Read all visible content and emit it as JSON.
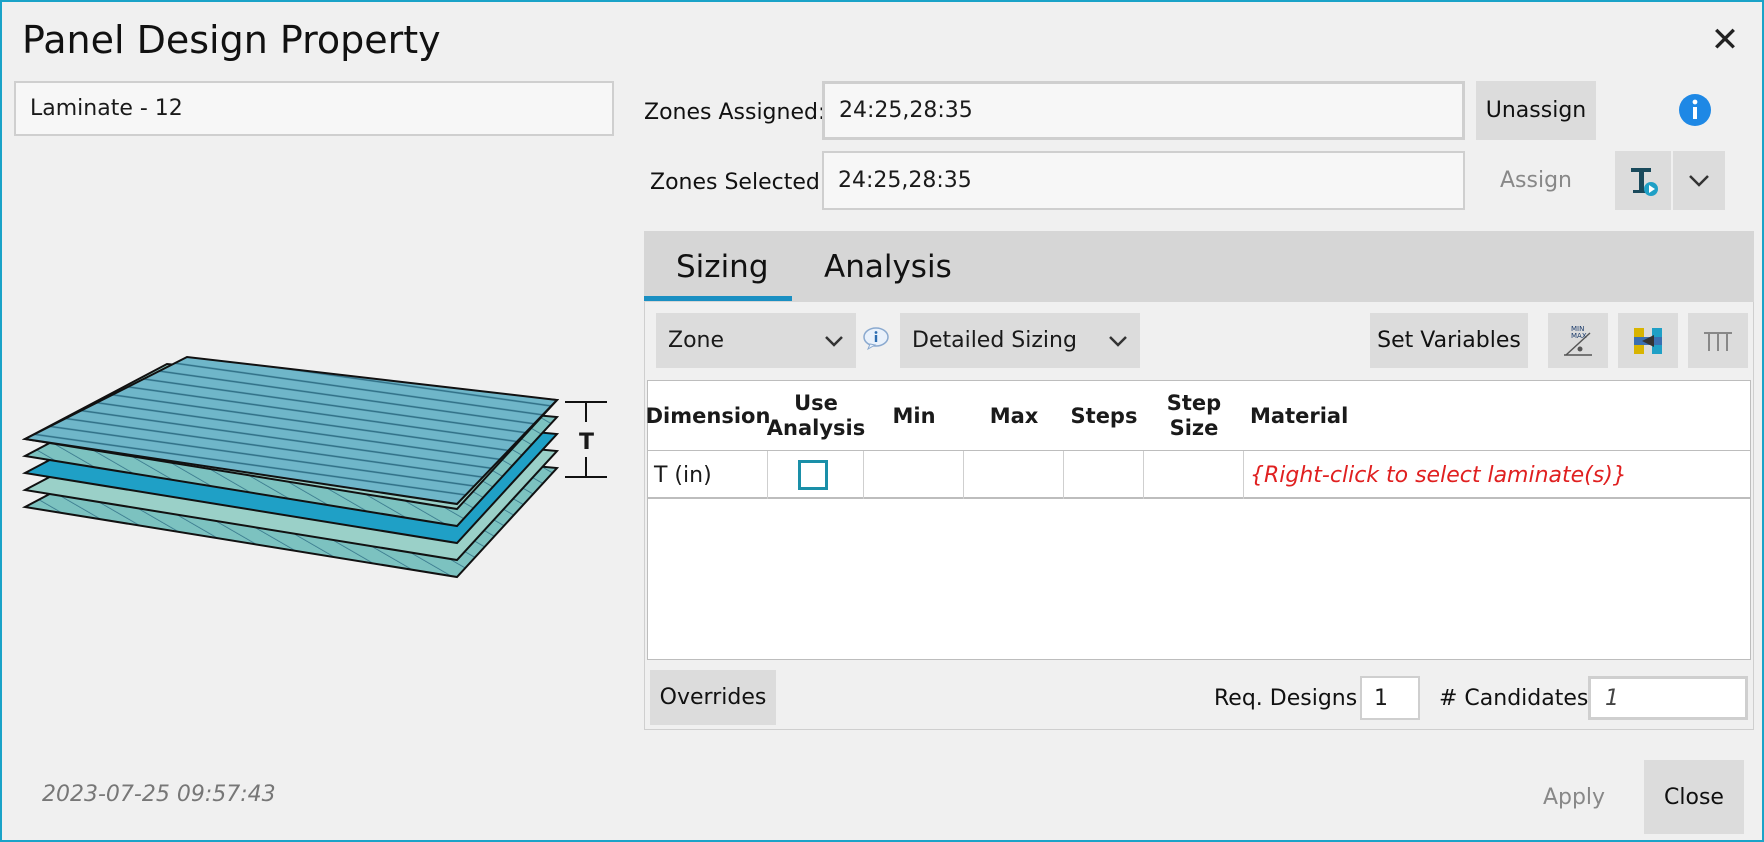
{
  "dialog": {
    "title": "Panel Design Property",
    "close_icon": "close-icon"
  },
  "laminate_name": "Laminate - 12",
  "zones": {
    "assigned_label": "Zones Assigned:",
    "assigned_value": "24:25,28:35",
    "selected_label": "Zones Selected:",
    "selected_value": "24:25,28:35",
    "unassign_label": "Unassign",
    "assign_label": "Assign"
  },
  "diagram": {
    "thickness_label": "T"
  },
  "tabs": [
    {
      "label": "Sizing",
      "active": true
    },
    {
      "label": "Analysis",
      "active": false
    }
  ],
  "sizing": {
    "scope_dropdown": "Zone",
    "mode_dropdown": "Detailed Sizing",
    "set_variables_label": "Set Variables",
    "columns": {
      "dimension": "Dimension",
      "use_analysis_1": "Use",
      "use_analysis_2": "Analysis",
      "min": "Min",
      "max": "Max",
      "steps": "Steps",
      "step_size_1": "Step",
      "step_size_2": "Size",
      "material": "Material"
    },
    "rows": [
      {
        "dimension": "T (in)",
        "use_analysis": false,
        "min": "",
        "max": "",
        "steps": "",
        "step_size": "",
        "material": "{Right-click to select laminate(s)}"
      }
    ],
    "overrides_label": "Overrides",
    "req_designs_label": "Req. Designs",
    "req_designs_value": "1",
    "candidates_label": "# Candidates",
    "candidates_value": "1"
  },
  "footer": {
    "timestamp": "2023-07-25 09:57:43",
    "apply_label": "Apply",
    "close_label": "Close"
  },
  "colors": {
    "accent": "#1a8fc2",
    "info_blue": "#1e88e5",
    "material_hint": "#e02020"
  }
}
